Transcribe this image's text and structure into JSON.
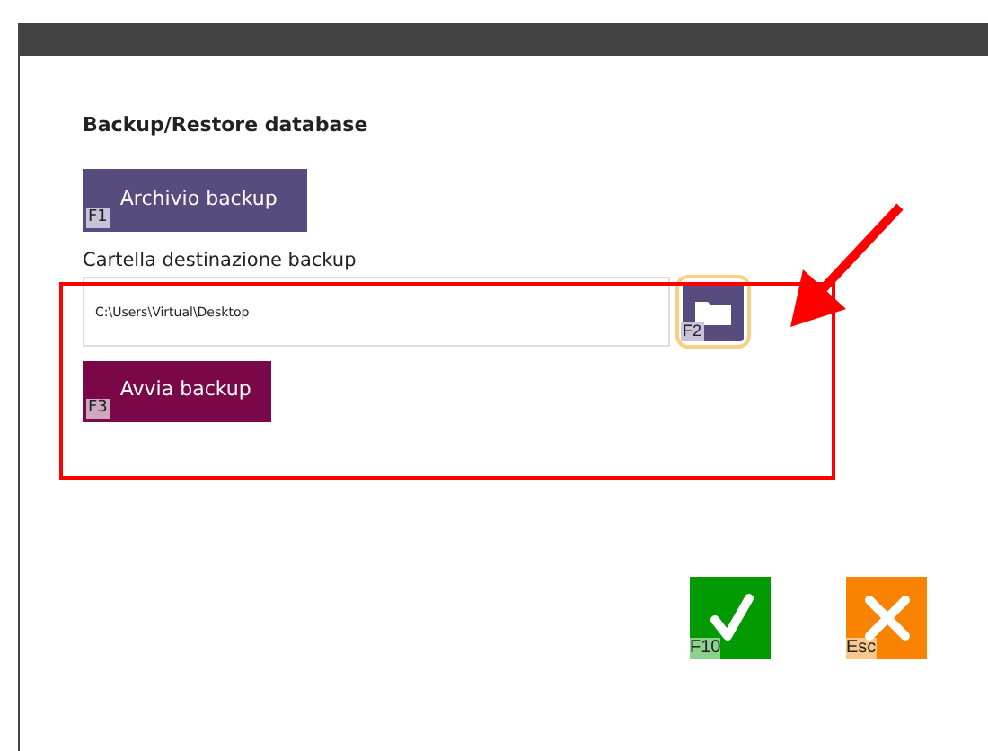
{
  "title": "Backup/Restore database",
  "archive_button": {
    "label": "Archivio backup",
    "key": "F1"
  },
  "destination": {
    "label": "Cartella destinazione backup",
    "value": "C:\\Users\\Virtual\\Desktop",
    "browse_key": "F2"
  },
  "start_button": {
    "label": "Avvia backup",
    "key": "F3"
  },
  "actions": [
    {
      "kind": "confirm",
      "key": "F10"
    },
    {
      "kind": "cancel",
      "key": "Esc"
    }
  ]
}
